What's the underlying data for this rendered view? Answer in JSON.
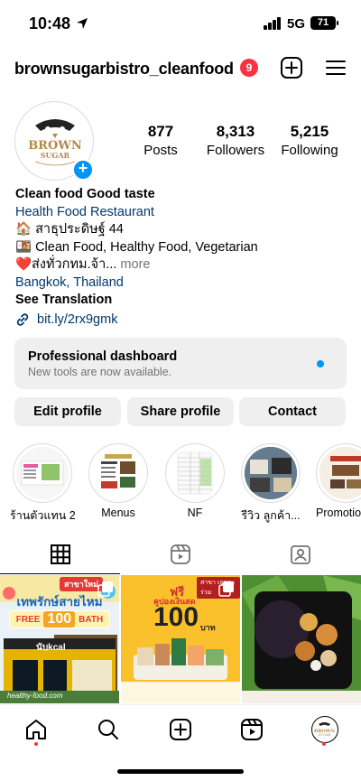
{
  "status_bar": {
    "time": "10:48",
    "network": "5G",
    "battery": "71"
  },
  "header": {
    "username": "brownsugarbistro_cleanfood",
    "notification_count": "9"
  },
  "profile": {
    "avatar_logo_text": "BROWN SUGAR",
    "stats": [
      {
        "value": "877",
        "label": "Posts"
      },
      {
        "value": "8,313",
        "label": "Followers"
      },
      {
        "value": "5,215",
        "label": "Following"
      }
    ]
  },
  "bio": {
    "name": "Clean food Good taste",
    "category": "Health Food Restaurant",
    "line1": "🏠 สาธุประดิษฐ์ 44",
    "line2": "🍱 Clean Food, Healthy Food, Vegetarian",
    "line3": "❤️ส่งทั่วกทม.จ้า...",
    "more": " more",
    "location": "Bangkok, Thailand",
    "see_translation": "See Translation"
  },
  "link": {
    "text": "bit.ly/2rx9gmk"
  },
  "dashboard": {
    "title": "Professional dashboard",
    "subtitle": "New tools are now available."
  },
  "buttons": {
    "edit": "Edit profile",
    "share": "Share profile",
    "contact": "Contact"
  },
  "highlights": [
    {
      "label": "ร้านตัวแทน 2..."
    },
    {
      "label": "Menus"
    },
    {
      "label": "NF"
    },
    {
      "label": "รีวิว ลูกค้า..."
    },
    {
      "label": "Promotio"
    }
  ],
  "posts": [
    {
      "banner": "สาขาใหม่",
      "headline": "เทพรักษ์สายไหม",
      "promo": "FREE",
      "promo_value": "100",
      "promo_unit": "BATH",
      "store": "นับkcal",
      "site": "healthy-food.com"
    },
    {
      "tag": "ฟรี",
      "coupon": "คูปองเงินสด",
      "amount": "100",
      "unit": "บาท",
      "corner": "สาขา เฉพาะร่วม"
    },
    {
      "caption": ""
    }
  ],
  "colors": {
    "accent": "#0095f6",
    "notification": "#ff3040",
    "link": "#00376b",
    "button_bg": "#efefef"
  }
}
